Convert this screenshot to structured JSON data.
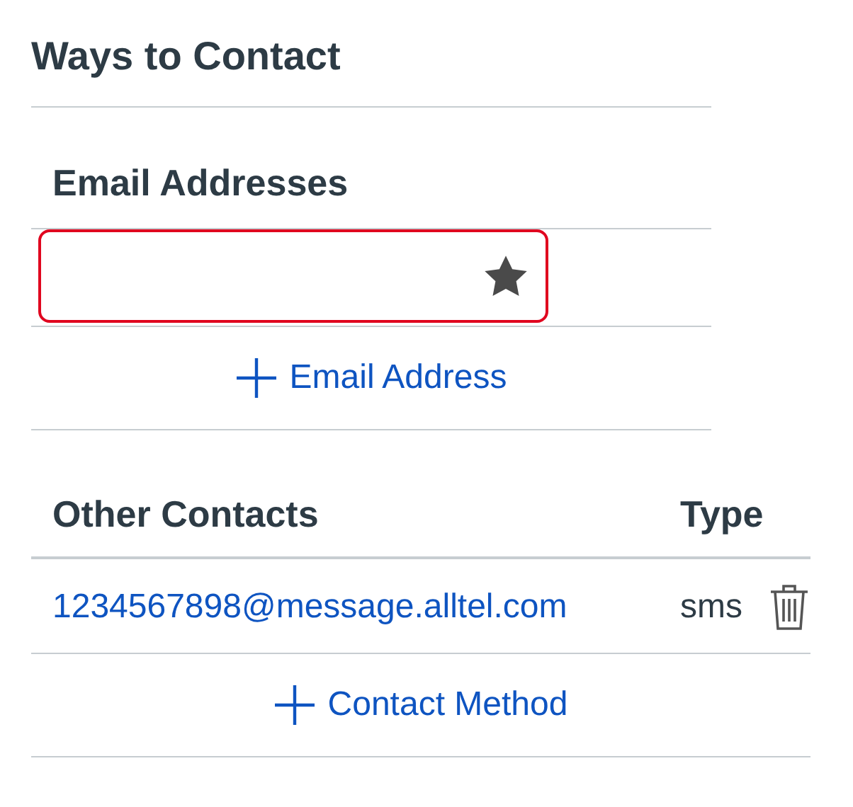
{
  "section_title": "Ways to Contact",
  "email": {
    "heading": "Email Addresses",
    "entries": [
      {
        "default": true,
        "highlighted": true
      }
    ],
    "add_label": "Email Address"
  },
  "other_contacts": {
    "columns": [
      "Other Contacts",
      "Type"
    ],
    "rows": [
      {
        "address": "1234567898@message.alltel.com",
        "type": "sms"
      }
    ],
    "add_label": "Contact Method"
  }
}
